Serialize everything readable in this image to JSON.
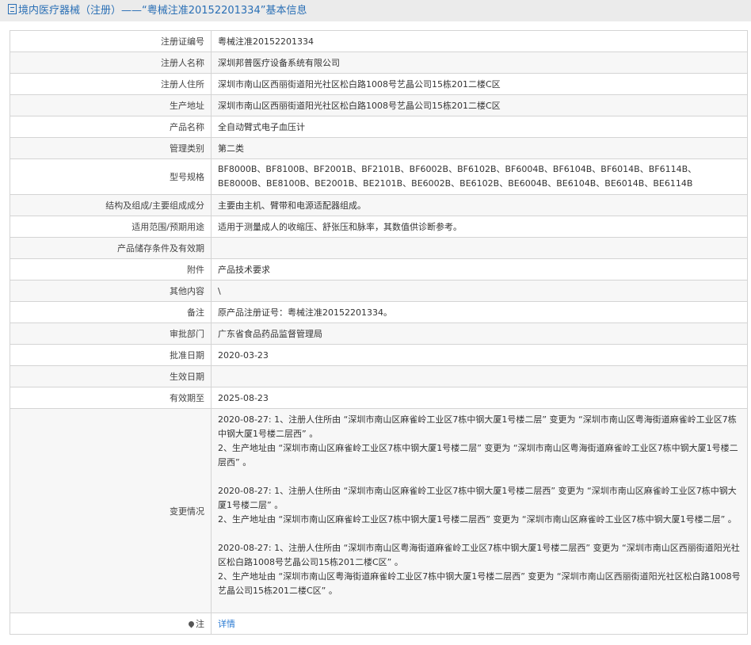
{
  "header": {
    "title": "境内医疗器械（注册）——“粤械注准20152201334”基本信息"
  },
  "rows": [
    {
      "label": "注册证编号",
      "value": "粤械注准20152201334"
    },
    {
      "label": "注册人名称",
      "value": "深圳邦普医疗设备系统有限公司"
    },
    {
      "label": "注册人住所",
      "value": "深圳市南山区西丽街道阳光社区松白路1008号艺晶公司15栋201二楼C区"
    },
    {
      "label": "生产地址",
      "value": "深圳市南山区西丽街道阳光社区松白路1008号艺晶公司15栋201二楼C区"
    },
    {
      "label": "产品名称",
      "value": "全自动臂式电子血压计"
    },
    {
      "label": "管理类别",
      "value": "第二类"
    },
    {
      "label": "型号规格",
      "value": "BF8000B、BF8100B、BF2001B、BF2101B、BF6002B、BF6102B、BF6004B、BF6104B、BF6014B、BF6114B、BE8000B、BE8100B、BE2001B、BE2101B、BE6002B、BE6102B、BE6004B、BE6104B、BE6014B、BE6114B"
    },
    {
      "label": "结构及组成/主要组成成分",
      "value": "主要由主机、臂带和电源适配器组成。"
    },
    {
      "label": "适用范围/预期用途",
      "value": "适用于测量成人的收缩压、舒张压和脉率，其数值供诊断参考。"
    },
    {
      "label": "产品储存条件及有效期",
      "value": ""
    },
    {
      "label": "附件",
      "value": "产品技术要求"
    },
    {
      "label": "其他内容",
      "value": "\\"
    },
    {
      "label": "备注",
      "value": "原产品注册证号：粤械注准20152201334。"
    },
    {
      "label": "审批部门",
      "value": "广东省食品药品监督管理局"
    },
    {
      "label": "批准日期",
      "value": "2020-03-23"
    },
    {
      "label": "生效日期",
      "value": ""
    },
    {
      "label": "有效期至",
      "value": "2025-08-23"
    }
  ],
  "changes": {
    "label": "变更情况",
    "entries": [
      [
        "2020-08-27: 1、注册人住所由 “深圳市南山区麻雀岭工业区7栋中钢大厦1号楼二层” 变更为 “深圳市南山区粤海街道麻雀岭工业区7栋中钢大厦1号楼二层西” 。",
        "2、生产地址由 “深圳市南山区麻雀岭工业区7栋中钢大厦1号楼二层” 变更为 “深圳市南山区粤海街道麻雀岭工业区7栋中钢大厦1号楼二层西” 。"
      ],
      [
        "2020-08-27: 1、注册人住所由 “深圳市南山区麻雀岭工业区7栋中钢大厦1号楼二层西” 变更为 “深圳市南山区麻雀岭工业区7栋中钢大厦1号楼二层” 。",
        "2、生产地址由 “深圳市南山区麻雀岭工业区7栋中钢大厦1号楼二层西” 变更为 “深圳市南山区麻雀岭工业区7栋中钢大厦1号楼二层” 。"
      ],
      [
        "2020-08-27: 1、注册人住所由 “深圳市南山区粤海街道麻雀岭工业区7栋中钢大厦1号楼二层西” 变更为 “深圳市南山区西丽街道阳光社区松白路1008号艺晶公司15栋201二楼C区” 。",
        "2、生产地址由 “深圳市南山区粤海街道麻雀岭工业区7栋中钢大厦1号楼二层西” 变更为 “深圳市南山区西丽街道阳光社区松白路1008号艺晶公司15栋201二楼C区” 。"
      ]
    ]
  },
  "note": {
    "label": "注",
    "link": "详情"
  }
}
